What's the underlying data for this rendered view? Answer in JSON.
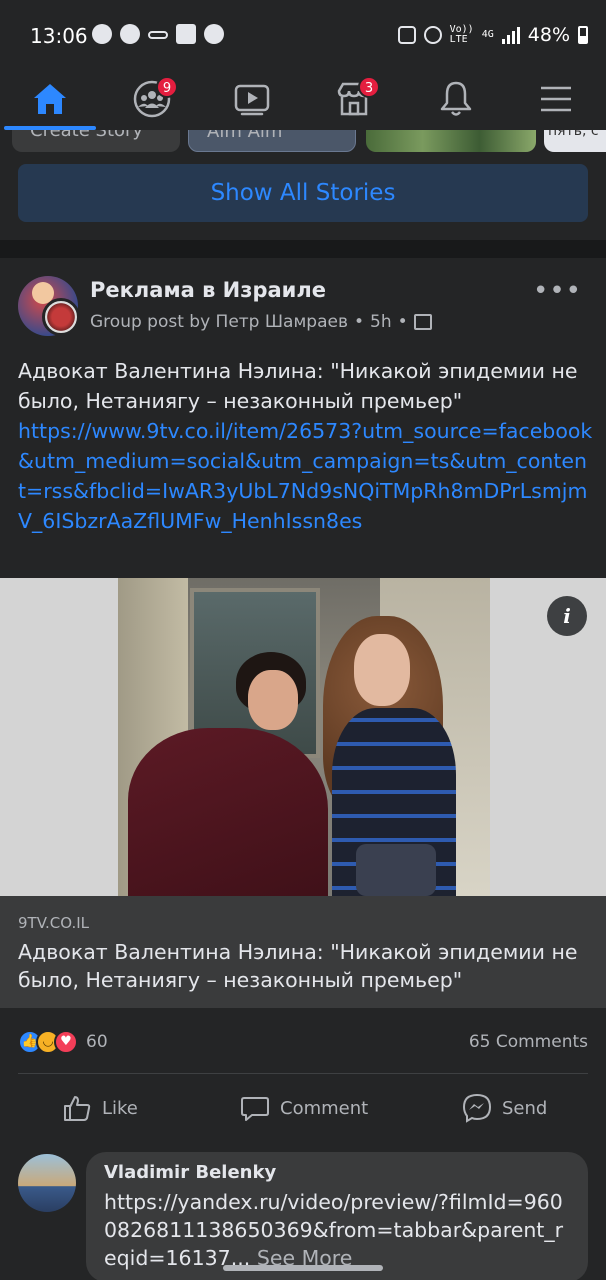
{
  "status_bar": {
    "time": "13:06",
    "battery": "48%",
    "volte_top": "Vo))",
    "volte_bottom": "LTE",
    "network": "4G"
  },
  "nav": {
    "items": [
      {
        "name": "home",
        "icon": "home-icon",
        "active": true
      },
      {
        "name": "groups",
        "icon": "groups-icon",
        "badge": "9"
      },
      {
        "name": "watch",
        "icon": "video-icon"
      },
      {
        "name": "marketplace",
        "icon": "marketplace-icon",
        "badge": "3"
      },
      {
        "name": "notifications",
        "icon": "bell-icon"
      },
      {
        "name": "menu",
        "icon": "hamburger-menu-icon"
      }
    ]
  },
  "stories": {
    "chip_1": "Create Story",
    "chip_2": "Alm Alm",
    "chip_4": "пять, с",
    "show_all_label": "Show All Stories"
  },
  "post": {
    "group_name": "Реклама в Израиле",
    "meta": "Group post by Петр Шамраев",
    "separator": "•",
    "time": "5h",
    "text": "Адвокат Валентина Нэлина: \"Никакой эпидемии не было, Нетаниягу – незаконный премьер\"",
    "link": "https://www.9tv.co.il/item/26573?utm_source=facebook&utm_medium=social&utm_campaign=ts&utm_content=rss&fbclid=IwAR3yUbL7Nd9sNQiTMpRh8mDPrLsmjmV_6ISbzrAaZflUMFw_HenhIssn8es",
    "preview": {
      "domain": "9TV.CO.IL",
      "title": "Адвокат Валентина Нэлина: \"Никакой эпидемии не было, Нетаниягу – незаконный премьер\"",
      "info_label": "i"
    },
    "reactions": {
      "count": "60",
      "types": [
        "like",
        "haha",
        "love"
      ],
      "colors": {
        "like": "#2d88ff",
        "haha": "#f7b125",
        "love": "#f33e58"
      }
    },
    "comments_count": "65 Comments",
    "actions": {
      "like": "Like",
      "comment": "Comment",
      "send": "Send"
    }
  },
  "comment": {
    "author": "Vladimir  Belenky",
    "text": "https://yandex.ru/video/preview/?filmId=9600826811138650369&from=tabbar&parent_reqid=16137",
    "ellipsis": "...",
    "see_more": "See More"
  },
  "colors": {
    "accent": "#2d88ff",
    "badge": "#e41e3f",
    "background": "#18191a",
    "card": "#242526"
  }
}
